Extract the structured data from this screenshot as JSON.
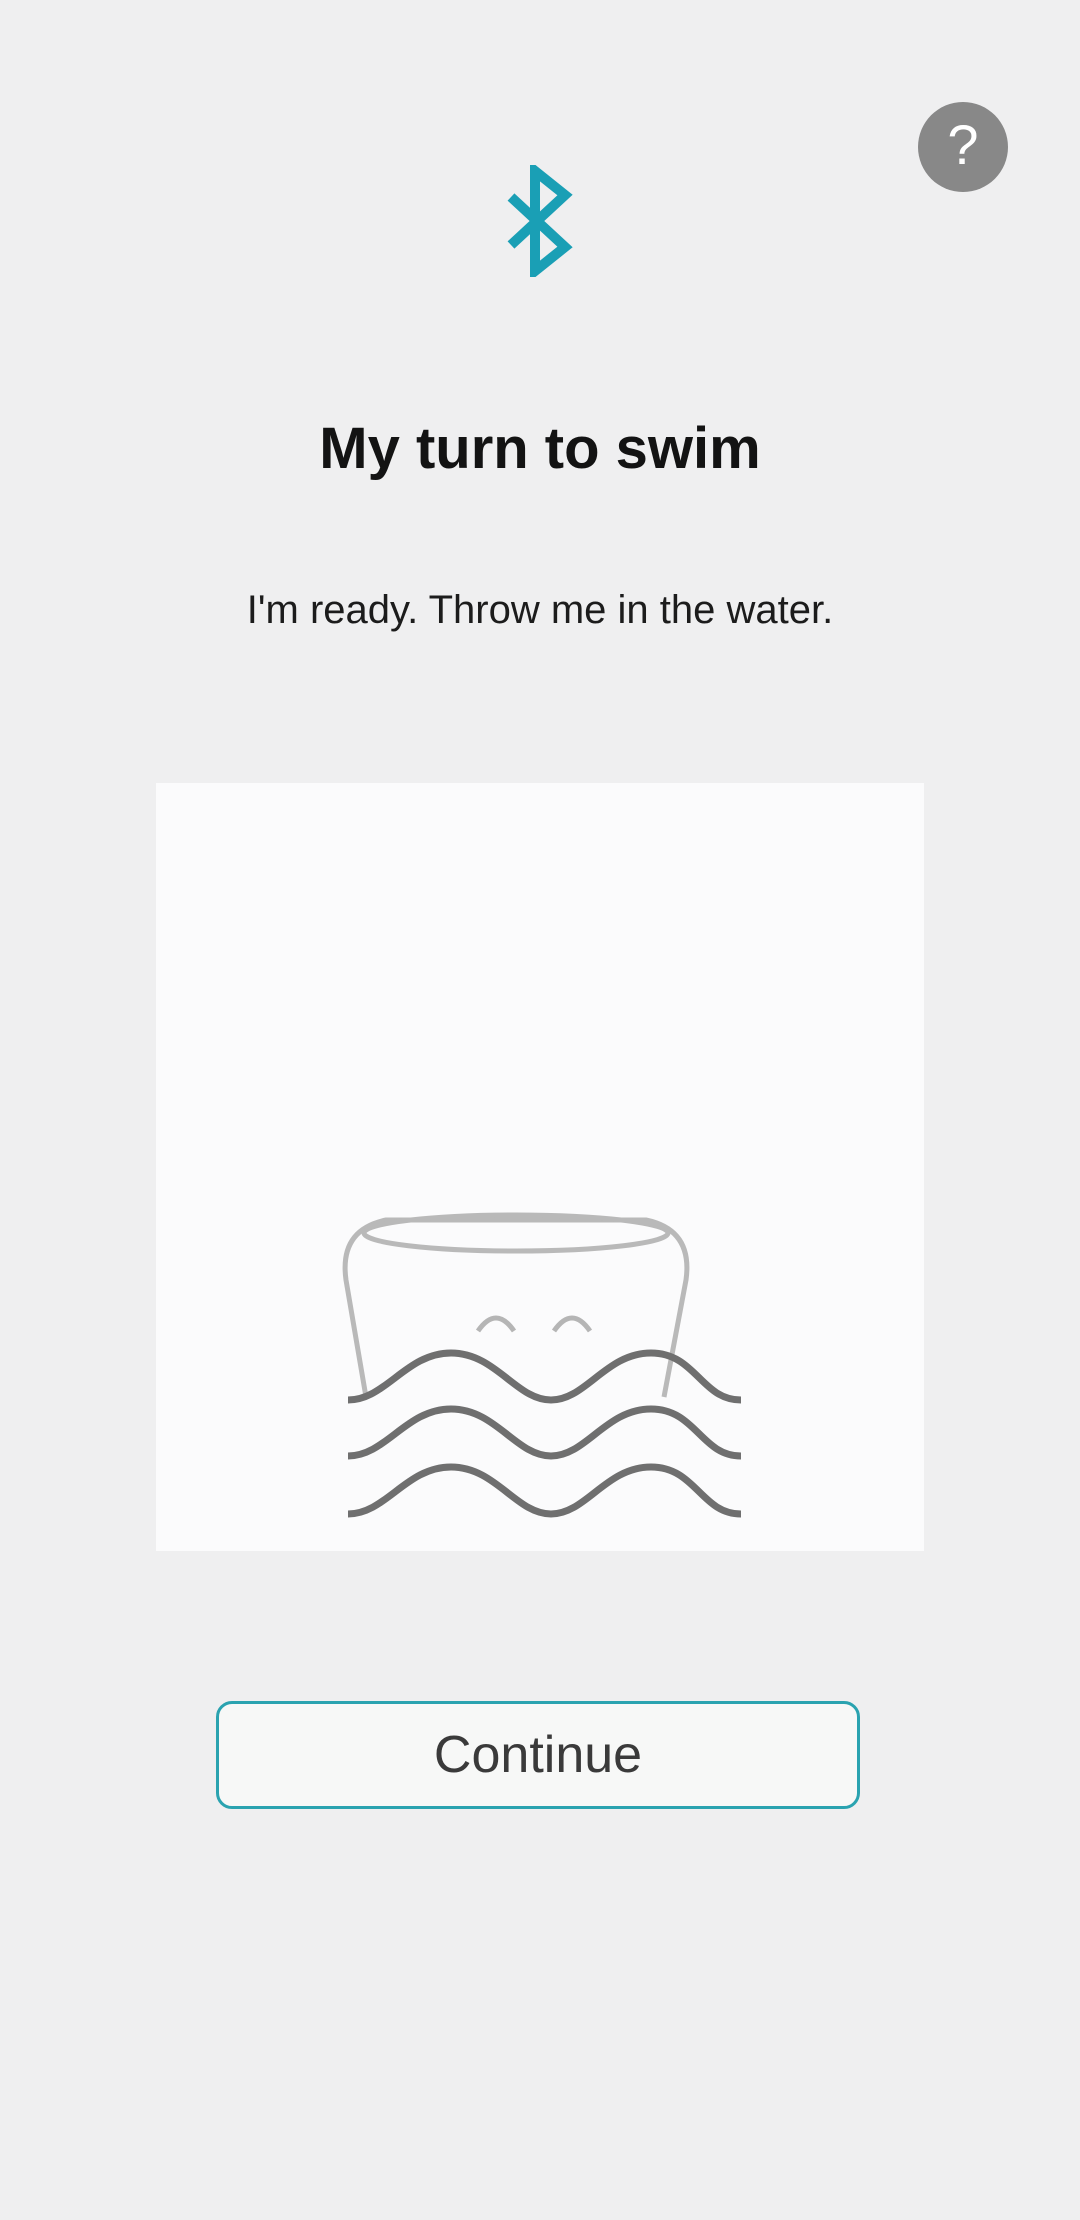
{
  "header": {
    "help_icon": "question-mark-icon",
    "help_label": "?",
    "status_icon": "bluetooth-icon"
  },
  "main": {
    "title": "My turn to swim",
    "subtitle": "I'm ready. Throw me in the water.",
    "illustration_icon": "device-in-water-icon"
  },
  "actions": {
    "continue_label": "Continue"
  },
  "colors": {
    "background": "#efeff0",
    "accent": "#1a9fb5",
    "button_border": "#2aa3b0",
    "help_bg": "#888888",
    "wave": "#6f6f6f"
  }
}
